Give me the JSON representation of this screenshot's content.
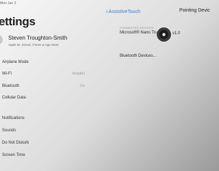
{
  "status_bar": {
    "date": "Mon Jun 3"
  },
  "settings": {
    "title": "ettings",
    "profile": {
      "name": "Steven Troughton-Smith",
      "subtitle": "Apple ID, iCloud, iTunes & App Store"
    },
    "items": [
      {
        "label": "Airplane Mode",
        "value": ""
      },
      {
        "label": "Wi-Fi",
        "value": "AmpliFi"
      },
      {
        "label": "Bluetooth",
        "value": "On"
      },
      {
        "label": "Cellular Data",
        "value": ""
      },
      {
        "label": "Notifications",
        "value": ""
      },
      {
        "label": "Sounds",
        "value": ""
      },
      {
        "label": "Do Not Disturb",
        "value": ""
      },
      {
        "label": "Screen Time",
        "value": ""
      }
    ]
  },
  "detail": {
    "back_label": "AssistiveTouch",
    "title": "Pointing Devic",
    "section_label": "CONNECTED DEVICES",
    "device_name": "Microsoft® Nano Tran",
    "device_version": "v1.0",
    "bluetooth_link": "Bluetooth Devices..."
  },
  "colors": {
    "accent": "#3a7bd5"
  },
  "icons": {
    "back": "chevron-left-icon",
    "pointer": "pointer-cursor-icon"
  }
}
